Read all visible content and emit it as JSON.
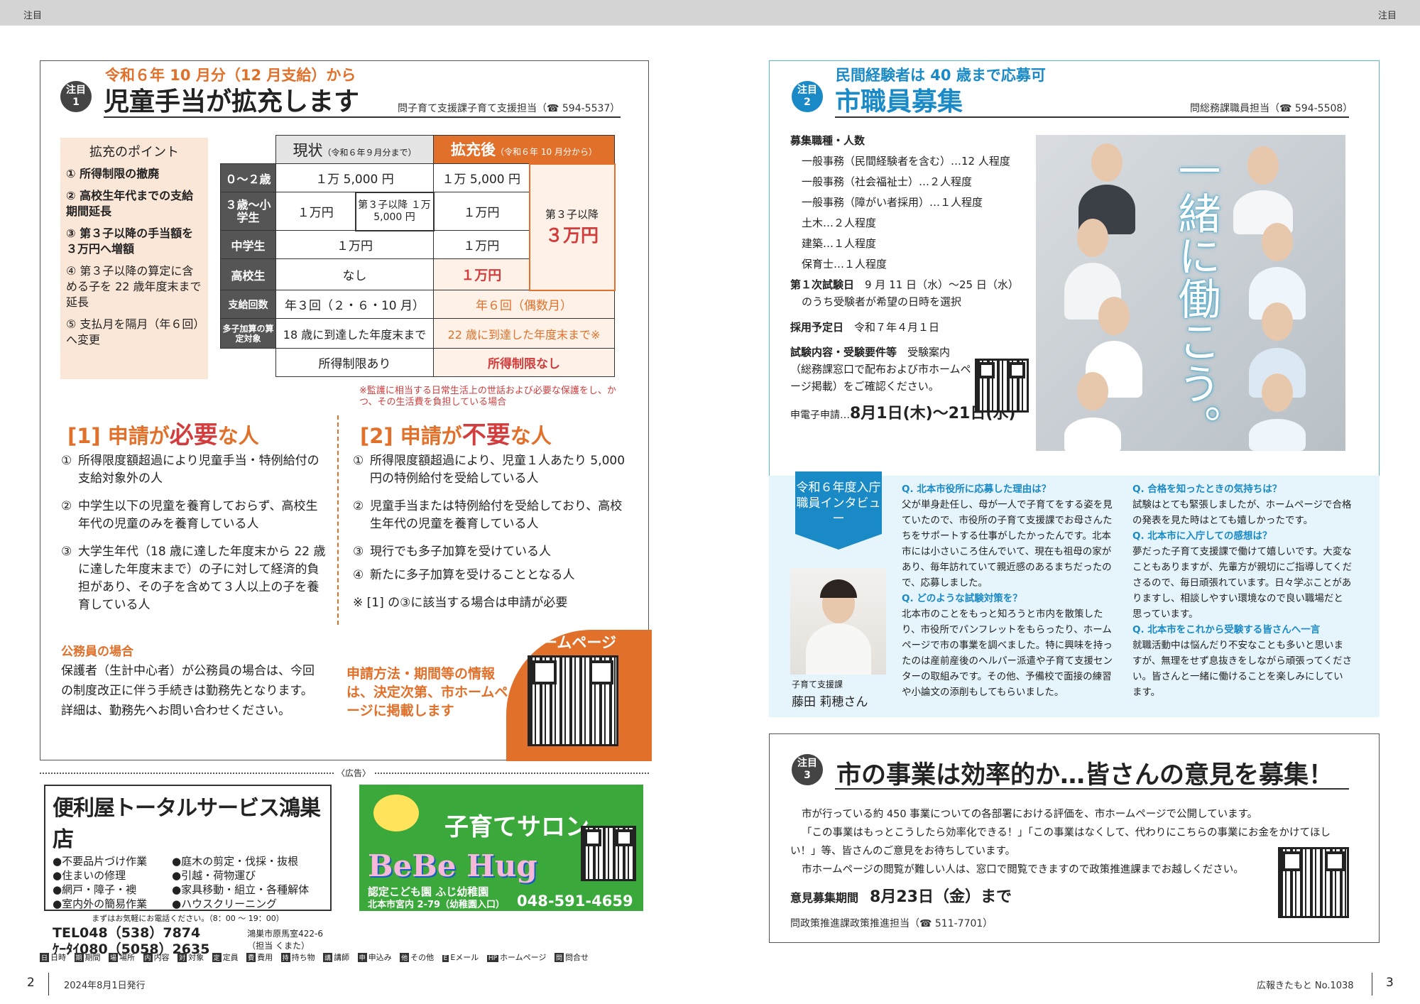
{
  "header": {
    "left": "注目",
    "right": "注目"
  },
  "notice1": {
    "badge": "注目\n1",
    "kicker": "令和６年 10 月分（12 月支給）から",
    "title": "児童手当が拡充します",
    "contact": "問子育て支援課子育て支援担当（☎ 594-5537）",
    "points_title": "拡充のポイント",
    "points": [
      "① 所得制限の撤廃",
      "② 高校生年代までの支給期間延長",
      "③ 第３子以降の手当額を３万円へ増額",
      "④ 第３子以降の算定に含める子を 22 歳年度末まで延長",
      "⑤ 支払月を隔月（年６回）へ変更"
    ],
    "table": {
      "head_old": "現状",
      "head_old_sub": "（令和６年９月分まで）",
      "head_new": "拡充後",
      "head_new_sub": "（令和６年 10 月分から）",
      "rows": [
        {
          "h": "０～２歳",
          "old": "１万 5,000 円",
          "new": "１万 5,000 円"
        },
        {
          "h": "３歳～小学生",
          "old": "１万円",
          "old2": "第３子以降 １万 5,000 円",
          "new": "１万円"
        },
        {
          "h": "中学生",
          "old": "１万円",
          "new": "１万円"
        },
        {
          "h": "高校生",
          "old": "なし",
          "new": "１万円"
        },
        {
          "h": "支給回数",
          "old": "年３回（２・６・10 月）",
          "new": "年６回（偶数月）"
        },
        {
          "h": "多子加算の算定対象",
          "old": "18 歳に到達した年度末まで",
          "new": "22 歳に到達した年度末まで※"
        },
        {
          "h": "",
          "old": "所得制限あり",
          "new": "所得制限なし"
        }
      ],
      "third_label": "第３子以降",
      "third_value": "３万円"
    },
    "note": "※監護に相当する日常生活上の世話および必要な保護をし、かつ、その生活費を負担している場合",
    "sec1_a": "[1] 申請が",
    "sec1_b": "必要",
    "sec1_c": "な人",
    "sec1_items": [
      "①",
      "所得限度額超過により児童手当・特例給付の支給対象外の人",
      "②",
      "中学生以下の児童を養育しておらず、高校生年代の児童のみを養育している人",
      "③",
      "大学生年代（18 歳に達した年度末から 22 歳に達した年度末まで）の子に対して経済的負担があり、その子を含めて３人以上の子を養育している人"
    ],
    "sec2_a": "[2] 申請が",
    "sec2_b": "不要",
    "sec2_c": "な人",
    "sec2_items": [
      "①",
      "所得限度額超過により、児童１人あたり 5,000 円の特例給付を受給している人",
      "②",
      "児童手当または特例給付を受給しており、高校生年代の児童を養育している人",
      "③",
      "現行でも多子加算を受けている人",
      "④",
      "新たに多子加算を受けることとなる人"
    ],
    "sec2_note": "※ [1] の③に該当する場合は申請が必要",
    "public_head": "公務員の場合",
    "public_text": "保護者（生計中心者）が公務員の場合は、今回の制度改正に伴う手続きは勤務先となります。詳細は、勤務先へお問い合わせください。",
    "info_text": "申請方法・期間等の情報は、決定次第、市ホームページに掲載します",
    "hp_label": "市ホームページ"
  },
  "ads": {
    "label": "〈広告〉",
    "ad1": {
      "name": "便利屋トータルサービス鴻巣店",
      "svcs": [
        "●不要品片づけ作業",
        "●庭木の剪定・伐採・抜根",
        "●住まいの修理",
        "●引越・荷物運び",
        "●網戸・障子・襖",
        "●家具移動・組立・各種解体",
        "●室内外の簡易作業",
        "●ハウスクリーニング"
      ],
      "hours": "まずはお気軽にお電話ください。（8：00 ～ 19：00）",
      "tel": "TEL048（538）7874",
      "mobile": "ｹｰﾀｲ080（5058）2635",
      "address": "鴻巣市原馬室422-6",
      "person": "（担当 くまた）"
    },
    "ad2": {
      "title": "子育てサロン",
      "logo": "BeBe Hug",
      "org": "認定こども園 ふじ幼稚園",
      "addr": "北本市宮内 2-79（幼稚園入口）",
      "tel": "048-591-4659"
    }
  },
  "legend": [
    [
      "日",
      "日時"
    ],
    [
      "期",
      "期間"
    ],
    [
      "場",
      "場所"
    ],
    [
      "内",
      "内容"
    ],
    [
      "対",
      "対象"
    ],
    [
      "定",
      "定員"
    ],
    [
      "費",
      "費用"
    ],
    [
      "持",
      "持ち物"
    ],
    [
      "講",
      "講師"
    ],
    [
      "申",
      "申込み"
    ],
    [
      "他",
      "その他"
    ],
    [
      "E",
      "Eメール"
    ],
    [
      "HP",
      "ホームページ"
    ],
    [
      "問",
      "問合せ"
    ]
  ],
  "footer": {
    "page_left": "2",
    "date": "2024年8月1日発行",
    "issue": "広報きたもと No.1038",
    "page_right": "3"
  },
  "notice2": {
    "badge": "注目\n2",
    "kicker": "民間経験者は 40 歳まで応募可",
    "title": "市職員募集",
    "contact": "問総務課職員担当（☎ 594-5508）",
    "jobs_head": "募集職種・人数",
    "jobs": [
      "一般事務（民間経験者を含む）…12 人程度",
      "一般事務（社会福祉士）…２人程度",
      "一般事務（障がい者採用）…１人程度",
      "土木…２人程度",
      "建築…１人程度",
      "保育士…１人程度"
    ],
    "exam_head": "第１次試験日",
    "exam_text": "9 月 11 日（水）～25 日（水）",
    "exam_text2": "のうち受験者が希望の日時を選択",
    "hire_head": "採用予定日",
    "hire_text": "令和７年４月１日",
    "content_head": "試験内容・受験要件等",
    "content_text": "受験案内（総務課窓口で配布および市ホームページ掲載）をご確認ください。",
    "apply_label": "申電子申請…",
    "apply_date": "8月1日(木)～21日(水)",
    "slogan": "一緒に働こう。",
    "ribbon": "令和６年度入庁職員インタビュー",
    "person_dept": "子育て支援課",
    "person_name": "藤田 莉穂さん",
    "qa_col1": [
      {
        "q": "Q. 北本市役所に応募した理由は？",
        "a": "父が単身赴任し、母が一人で子育てをする姿を見ていたので、市役所の子育て支援課でお母さんたちをサポートする仕事がしたかったんです。北本市には小さいころ住んでいて、現在も祖母の家があり、毎年訪れていて親近感のあるまちだったので、応募しました。"
      },
      {
        "q": "Q. どのような試験対策を？",
        "a": "北本市のことをもっと知ろうと市内を散策したり、市役所でパンフレットをもらったり、ホームページで市の事業を調べました。特に興味を持ったのは産前産後のヘルパー派遣や子育て支援センターの取組みです。その他、予備校で面接の練習や小論文の添削もしてもらいました。"
      }
    ],
    "qa_col2": [
      {
        "q": "Q. 合格を知ったときの気持ちは？",
        "a": "試験はとても緊張しましたが、ホームページで合格の発表を見た時はとても嬉しかったです。"
      },
      {
        "q": "Q. 北本市に入庁しての感想は？",
        "a": "夢だった子育て支援課で働けて嬉しいです。大変なこともありますが、先輩方が親切にご指導してくださるので、毎日頑張れています。日々学ぶことがありますし、相談しやすい環境なので良い職場だと思っています。"
      },
      {
        "q": "Q. 北本市をこれから受験する皆さんへ一言",
        "a": "就職活動中は悩んだり不安なことも多いと思いますが、無理をせず息抜きをしながら頑張ってください。皆さんと一緒に働けることを楽しみにしています。"
      }
    ]
  },
  "notice3": {
    "badge": "注目\n3",
    "title": "市の事業は効率的か…皆さんの意見を募集！",
    "p1": "市が行っている約 450 事業についての各部署における評価を、市ホームページで公開しています。",
    "p2": "「この事業はもっとこうしたら効率化できる！」「この事業はなくして、代わりにこちらの事業にお金をかけてほしい！」等、皆さんのご意見をお待ちしています。",
    "p3": "市ホームページの閲覧が難しい人は、窓口で閲覧できますので政策推進課までお越しください。",
    "period_head": "意見募集期間",
    "period_date": "8月23日（金）まで",
    "contact": "問政策推進課政策推進担当（☎ 511-7701）"
  }
}
